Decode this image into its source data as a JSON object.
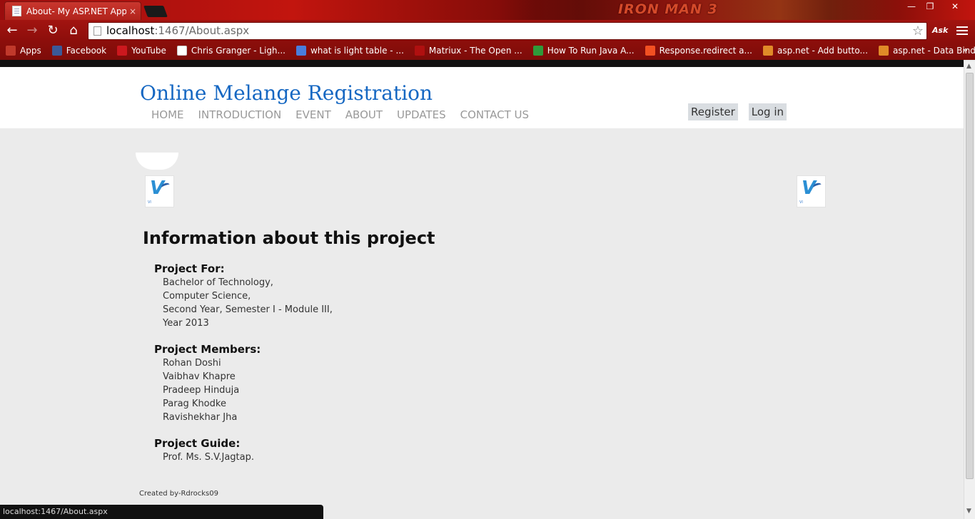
{
  "browser": {
    "tab_title": "About- My ASP.NET Appl",
    "tab_close": "×",
    "url_host": "localhost",
    "url_rest": ":1467/About.aspx",
    "title_brand": "IRON MAN 3",
    "ask_label": "Ask",
    "bookmarks": [
      {
        "label": "Apps",
        "color": "#c0392b"
      },
      {
        "label": "Facebook",
        "color": "#3b5998"
      },
      {
        "label": "YouTube",
        "color": "#cc181e"
      },
      {
        "label": "Chris Granger - Ligh...",
        "color": "#ffffff"
      },
      {
        "label": "what is light table - ...",
        "color": "#4a7ddc"
      },
      {
        "label": "Matriux - The Open ...",
        "color": "#b01010"
      },
      {
        "label": "How To Run Java A...",
        "color": "#2f9a3a"
      },
      {
        "label": "Response.redirect a...",
        "color": "#f25022"
      },
      {
        "label": "asp.net - Add butto...",
        "color": "#e08a28"
      },
      {
        "label": "asp.net - Data Bind ...",
        "color": "#e08a28"
      }
    ],
    "bookmarks_more": "»",
    "status_url": "localhost:1467/About.aspx"
  },
  "site": {
    "title": "Online Melange Registration",
    "menu": [
      "HOME",
      "INTRODUCTION",
      "EVENT",
      "ABOUT",
      "UPDATES",
      "CONTACT US"
    ],
    "register": "Register",
    "login": "Log in",
    "logo_letter": "V",
    "logo_small": "VI"
  },
  "content": {
    "heading": "Information about this project",
    "project_for_label": "Project For:",
    "project_for": [
      "Bachelor of Technology,",
      "Computer Science,",
      "Second Year, Semester I - Module III,",
      "Year 2013"
    ],
    "members_label": "Project Members:",
    "members": [
      "Rohan Doshi",
      "Vaibhav Khapre",
      "Pradeep Hinduja",
      "Parag Khodke",
      "Ravishekhar Jha"
    ],
    "guide_label": "Project Guide:",
    "guide": [
      "Prof. Ms. S.V.Jagtap."
    ]
  },
  "footer": {
    "created_by": "Created by-Rdrocks09"
  }
}
